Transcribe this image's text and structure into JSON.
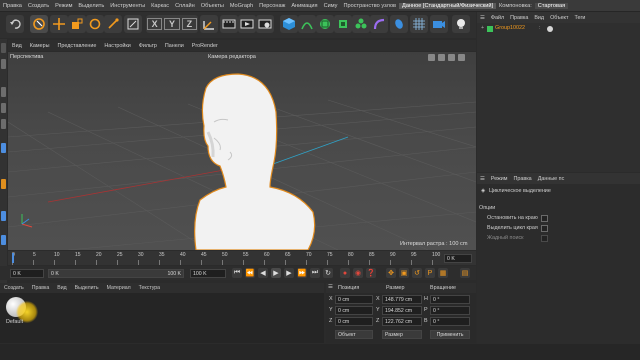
{
  "menu": {
    "items": [
      "Правка",
      "Создать",
      "Режим",
      "Выделить",
      "Инструменты",
      "Каркас",
      "Сплайн",
      "Объекты",
      "MoGraph",
      "Персонаж",
      "Анимация",
      "Симу",
      "Пространство узлов"
    ],
    "highlight": "Данное [Стандартный/Физический]",
    "tabs": [
      "Компоновка:",
      "Стартовая"
    ]
  },
  "toolbar": {
    "axes": [
      "X",
      "Y",
      "Z"
    ],
    "accent": "#f29a1e"
  },
  "viewport": {
    "menu": [
      "Вид",
      "Камеры",
      "Представление",
      "Настройки",
      "Фильтр",
      "Панели",
      "ProRender"
    ],
    "label_view": "Перспектива",
    "label_camera": "Камера редактора",
    "grid_info": "Интервал растра : 100 cm"
  },
  "timeline": {
    "ticks": [
      "0",
      "5",
      "10",
      "15",
      "20",
      "25",
      "30",
      "35",
      "40",
      "45",
      "50",
      "55",
      "60",
      "65",
      "70",
      "75",
      "80",
      "85",
      "90",
      "95",
      "100"
    ],
    "end_label": "0 K"
  },
  "playback": {
    "start": "0 K",
    "current": "0 K",
    "end": "100 K",
    "end2": "100 K"
  },
  "materials": {
    "menu": [
      "Создать",
      "Правка",
      "Вид",
      "Выделить",
      "Материал",
      "Текстура"
    ],
    "item_label": "Default"
  },
  "coordinates": {
    "headers": [
      "Позиция",
      "Размер",
      "Вращение"
    ],
    "rows": [
      {
        "axis": "X",
        "pos": "0 cm",
        "size": "148.779 cm",
        "rot_axis": "H",
        "rot": "0 °"
      },
      {
        "axis": "Y",
        "pos": "0 cm",
        "size": "194.852 cm",
        "rot_axis": "P",
        "rot": "0 °"
      },
      {
        "axis": "Z",
        "pos": "0 cm",
        "size": "122.762 cm",
        "rot_axis": "B",
        "rot": "0 °"
      }
    ],
    "mode": "Объект",
    "size_mode": "Размер",
    "apply": "Применить"
  },
  "object_manager": {
    "menu": [
      "Файл",
      "Правка",
      "Вид",
      "Объект",
      "Теги"
    ],
    "object_name": "Group10022"
  },
  "attributes": {
    "menu": [
      "Режим",
      "Правка",
      "Данные пс"
    ],
    "title": "Циклическое выделение",
    "section": "Опции",
    "options": [
      "Остановить на краю",
      "Выделить цикл края",
      "Жадный поиск"
    ]
  }
}
